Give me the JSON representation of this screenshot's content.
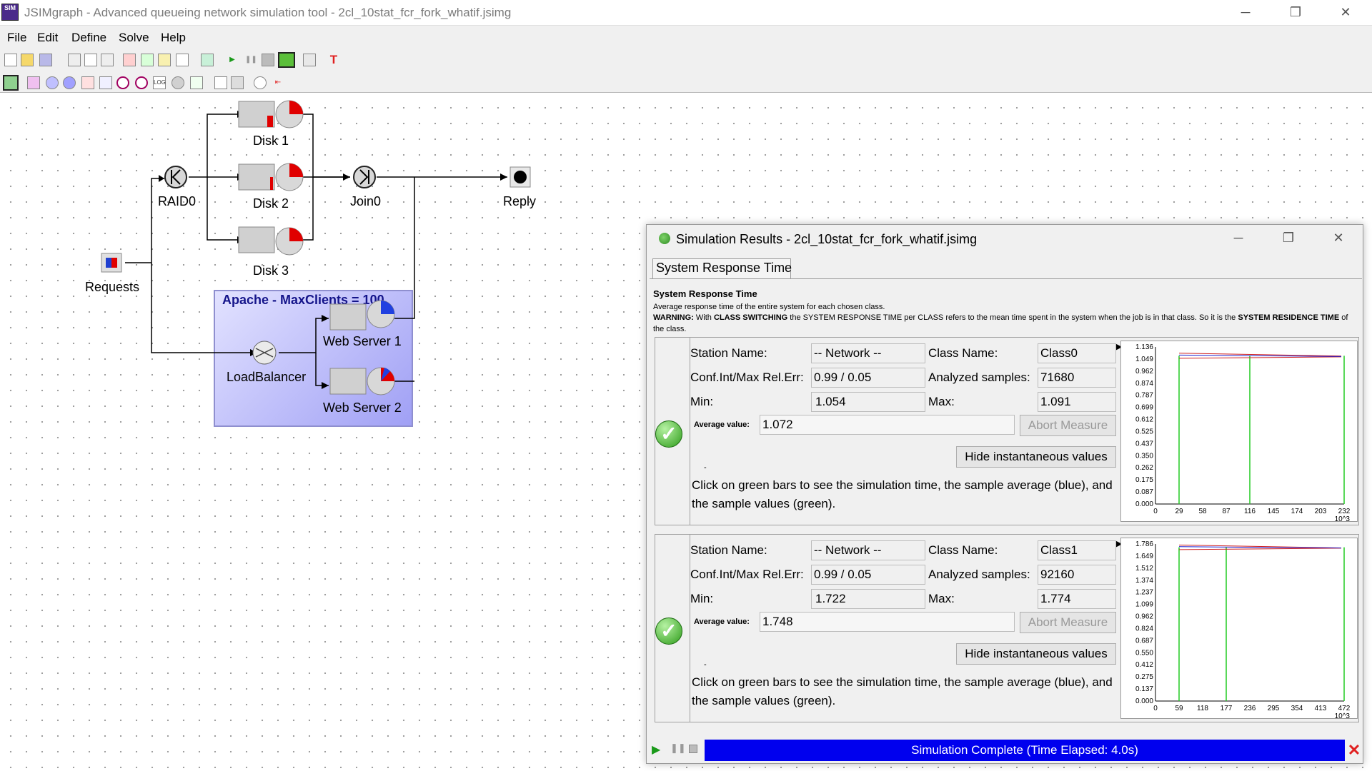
{
  "window": {
    "title": "JSIMgraph - Advanced queueing network simulation tool - 2cl_10stat_fcr_fork_whatif.jsimg",
    "app_icon": "SIM",
    "minimize": "─",
    "restore": "❐",
    "close": "✕"
  },
  "menu": [
    "File",
    "Edit",
    "Define",
    "Solve",
    "Help"
  ],
  "nodes": {
    "disk1": "Disk 1",
    "disk2": "Disk 2",
    "disk3": "Disk 3",
    "raid0": "RAID0",
    "join0": "Join0",
    "reply": "Reply",
    "requests": "Requests",
    "apache": "Apache - MaxClients = 100",
    "web1": "Web Server 1",
    "web2": "Web Server 2",
    "loadbalancer": "LoadBalancer"
  },
  "results_window": {
    "title": "Simulation Results - 2cl_10stat_fcr_fork_whatif.jsimg",
    "tab": "System Response Time",
    "heading": "System Response Time",
    "description": "Average response time of the entire system for each chosen class.",
    "warning_prefix": "WARNING:",
    "warning_text_1": " With ",
    "warning_bold_1": "CLASS SWITCHING",
    "warning_text_2": " the SYSTEM RESPONSE TIME per CLASS refers to the mean time spent in the system when the job is in that class. So it is the ",
    "warning_bold_2": "SYSTEM RESIDENCE TIME",
    "warning_text_3": " of the class.",
    "labels": {
      "station": "Station Name:",
      "class": "Class Name:",
      "conf": "Conf.Int/Max Rel.Err:",
      "samples": "Analyzed samples:",
      "min": "Min:",
      "max": "Max:",
      "avg": "Average value:",
      "abort": "Abort Measure",
      "hide": "Hide instantaneous values",
      "click_info": "Click on green bars to see the simulation time, the sample average (blue), and the sample values (green).",
      "dash": "-"
    },
    "measures": [
      {
        "station": "-- Network --",
        "class": "Class0",
        "conf": "0.99 / 0.05",
        "samples": "71680",
        "min": "1.054",
        "max": "1.091",
        "avg": "1.072",
        "chart": {
          "y_ticks": [
            "1.136",
            "1.049",
            "0.962",
            "0.874",
            "0.787",
            "0.699",
            "0.612",
            "0.525",
            "0.437",
            "0.350",
            "0.262",
            "0.175",
            "0.087",
            "0.000"
          ],
          "x_ticks": [
            "0",
            "29",
            "58",
            "87",
            "116",
            "145",
            "174",
            "203",
            "232"
          ],
          "x_unit": "10^3",
          "green_bars_x": [
            29,
            116,
            232
          ]
        }
      },
      {
        "station": "-- Network --",
        "class": "Class1",
        "conf": "0.99 / 0.05",
        "samples": "92160",
        "min": "1.722",
        "max": "1.774",
        "avg": "1.748",
        "chart": {
          "y_ticks": [
            "1.786",
            "1.649",
            "1.512",
            "1.374",
            "1.237",
            "1.099",
            "0.962",
            "0.824",
            "0.687",
            "0.550",
            "0.412",
            "0.275",
            "0.137",
            "0.000"
          ],
          "x_ticks": [
            "0",
            "59",
            "118",
            "177",
            "236",
            "295",
            "354",
            "413",
            "472"
          ],
          "x_unit": "10^3",
          "green_bars_x": [
            59,
            177,
            472
          ]
        }
      }
    ],
    "status": "Simulation Complete (Time Elapsed: 4.0s)"
  }
}
